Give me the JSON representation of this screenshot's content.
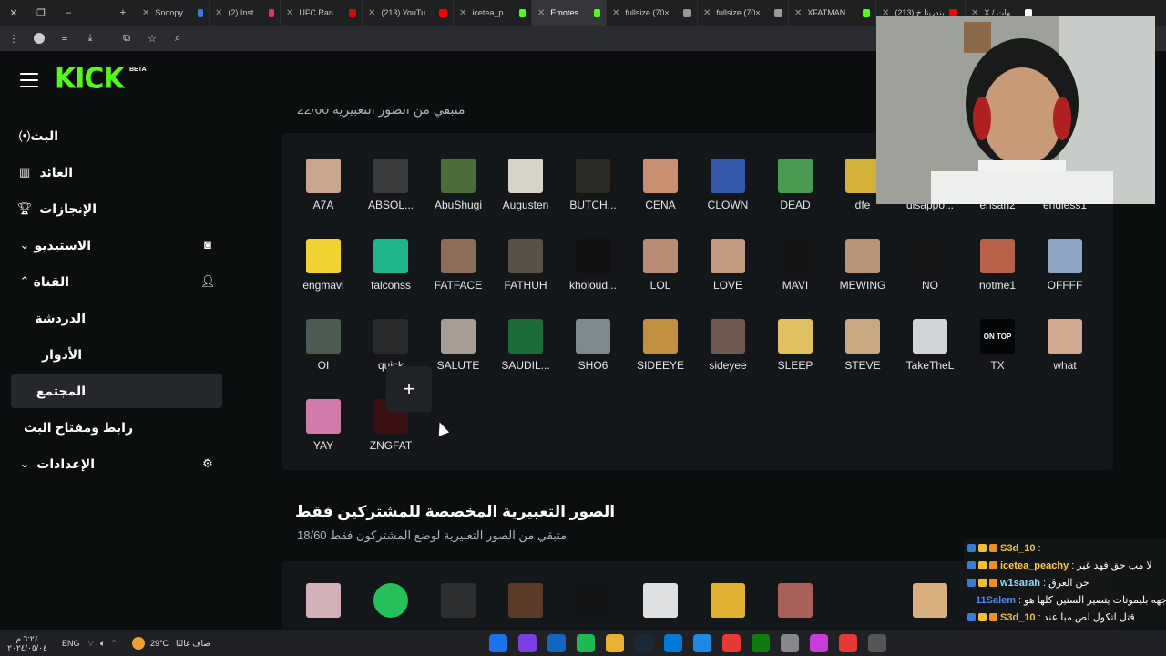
{
  "browser": {
    "tabs": [
      {
        "title": "Snoopy Mad G",
        "color": "#3a7bd5"
      },
      {
        "title": "(2) Instagram",
        "color": "#e1306c"
      },
      {
        "title": "UFC Rankings",
        "color": "#d20a0a"
      },
      {
        "title": "(213) YouTube",
        "color": "#ff0000"
      },
      {
        "title": "icetea_peachy",
        "color": "#53fc18"
      },
      {
        "title": "Emotes - Kick",
        "color": "#53fc18"
      },
      {
        "title": "fullsize (70×70)",
        "color": "#999999"
      },
      {
        "title": "fullsize (70×70)",
        "color": "#999999"
      },
      {
        "title": "XFATMAN31 St",
        "color": "#53fc18"
      },
      {
        "title": "(213) بندريتا خ",
        "color": "#ff0000"
      },
      {
        "title": "X / التنبيهات",
        "color": "#ffffff"
      }
    ]
  },
  "kick": {
    "logo": "KICK",
    "beta": "BETA"
  },
  "sidebar": {
    "items": [
      {
        "label": "البث",
        "icon": "broadcast-icon"
      },
      {
        "label": "العائد",
        "icon": "chart-icon"
      },
      {
        "label": "الإنجازات",
        "icon": "trophy-icon"
      },
      {
        "label": "الاستيديو",
        "icon": "chevron-down-icon"
      },
      {
        "label": "القناة",
        "icon": "chevron-up-icon"
      },
      {
        "label": "الدردشة",
        "icon": ""
      },
      {
        "label": "الأدوار",
        "icon": ""
      },
      {
        "label": "المجتمع",
        "icon": ""
      },
      {
        "label": "رابط ومفتاح البث",
        "icon": ""
      },
      {
        "label": "الإعدادات",
        "icon": "chevron-down-icon"
      }
    ]
  },
  "main": {
    "top_remaining": "متبقي من الصور التعبيرية 22/60",
    "subs_title": "الصور التعبيرية المخصصة للمشتركين فقط",
    "subs_remaining": "متبقي من الصور التعبيرية لوضع المشتركون فقط 18/60",
    "add_label": "+"
  },
  "emotes": [
    {
      "name": "A7A",
      "color": "#c9a48f"
    },
    {
      "name": "ABSOL...",
      "color": "#3b3b3b"
    },
    {
      "name": "AbuShugi",
      "color": "#4e6b3a"
    },
    {
      "name": "Augusten",
      "color": "#d8d3c8"
    },
    {
      "name": "BUTCH...",
      "color": "#2c2a26"
    },
    {
      "name": "CENA",
      "color": "#c89070"
    },
    {
      "name": "CLOWN",
      "color": "#3458a8"
    },
    {
      "name": "DEAD",
      "color": "#4a9a52"
    },
    {
      "name": "dfe",
      "color": "#d4b23a"
    },
    {
      "name": "disappo...",
      "color": "#777777"
    },
    {
      "name": "ehsan2",
      "color": "#555555"
    },
    {
      "name": "endless1",
      "color": "#666666"
    },
    {
      "name": "engmavi",
      "color": "#f0d230"
    },
    {
      "name": "falconss",
      "color": "#1fb58a"
    },
    {
      "name": "FATFACE",
      "color": "#8d6e5a"
    },
    {
      "name": "FATHUH",
      "color": "#5a5148"
    },
    {
      "name": "kholoud...",
      "color": "#111111"
    },
    {
      "name": "LOL",
      "color": "#b88c74"
    },
    {
      "name": "LOVE",
      "color": "#c29a80"
    },
    {
      "name": "MAVI",
      "color": "#151515"
    },
    {
      "name": "MEWING",
      "color": "#b89478"
    },
    {
      "name": "NO",
      "color": "#161616"
    },
    {
      "name": "notme1",
      "color": "#b8624a"
    },
    {
      "name": "OFFFF",
      "color": "#8ea4c2"
    },
    {
      "name": "OI",
      "color": "#4d5a52"
    },
    {
      "name": "quick",
      "color": "#2a2a2a"
    },
    {
      "name": "SALUTE",
      "color": "#a89c94"
    },
    {
      "name": "SAUDIL...",
      "color": "#1c6b3a"
    },
    {
      "name": "SHO6",
      "color": "#7f8a90"
    },
    {
      "name": "SIDEEYE",
      "color": "#c09040"
    },
    {
      "name": "sideyee",
      "color": "#6f5a52"
    },
    {
      "name": "SLEEP",
      "color": "#e0c060"
    },
    {
      "name": "STEVE",
      "color": "#c8a880"
    },
    {
      "name": "TakeTheL",
      "color": "#d0d4d8"
    },
    {
      "name": "TX",
      "color": "#050505",
      "text": "ON TOP"
    },
    {
      "name": "what",
      "color": "#d0a890"
    },
    {
      "name": "YAY",
      "color": "#d27aa8"
    },
    {
      "name": "ZNGFAT",
      "color": "#3a1010"
    }
  ],
  "sub_emotes": [
    {
      "color": "#d2b0b8"
    },
    {
      "color": "#25c05a"
    },
    {
      "color": "#2e2e2e"
    },
    {
      "color": "#5a3a28"
    },
    {
      "color": "#131516"
    },
    {
      "color": "#e0e0e0"
    },
    {
      "color": "#e0b030"
    },
    {
      "color": "#a86058"
    },
    {
      "color": "#141719"
    },
    {
      "color": "#d8b080"
    }
  ],
  "chat": [
    {
      "user": "S3d_10",
      "color": "#f0c030",
      "msg": ""
    },
    {
      "user": "icetea_peachy",
      "color": "#ffcc33",
      "msg": "لا مب حق فهد غير"
    },
    {
      "user": "w1sarah",
      "color": "#8fe0ff",
      "msg": "حن العرق"
    },
    {
      "user": "11Salem",
      "color": "#4a8cff",
      "msg": "ايزو لو يرضى نستخدم وجهه بليموتات يتصير الستين كلها هو"
    },
    {
      "user": "S3d_10",
      "color": "#f0c030",
      "msg": "قتل اتكول لص مبا عند"
    }
  ],
  "taskbar": {
    "time": "٦:٢٤ م",
    "date": "٢٠٢٤/٠٥/٠٤",
    "lang": "ENG",
    "weather": "29°C",
    "weather_text": "صاف غالبًا"
  }
}
